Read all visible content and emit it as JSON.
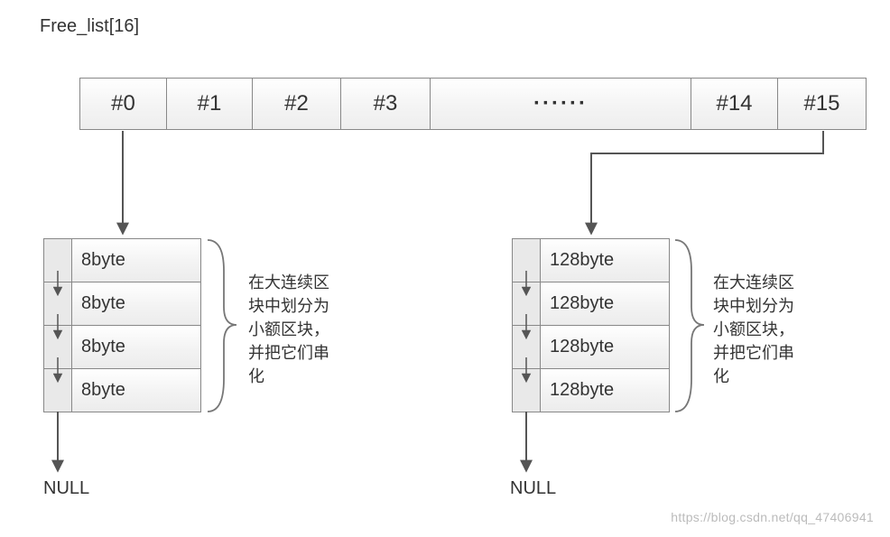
{
  "title": "Free_list[16]",
  "array": {
    "cells": [
      "#0",
      "#1",
      "#2",
      "#3",
      "······",
      "#14",
      "#15"
    ]
  },
  "leftList": {
    "nodeLabel": "8byte",
    "count": 4,
    "null": "NULL"
  },
  "rightList": {
    "nodeLabel": "128byte",
    "count": 4,
    "null": "NULL"
  },
  "annotation": "在大连续区块中划分为小额区块，并把它们串化",
  "watermark": "https://blog.csdn.net/qq_47406941",
  "chart_data": {
    "type": "diagram",
    "structure": "free_list_array_with_linked_lists",
    "array_name": "Free_list",
    "array_size": 16,
    "shown_indices": [
      0,
      1,
      2,
      3,
      14,
      15
    ],
    "lists": [
      {
        "from_index": 0,
        "block_size_bytes": 8,
        "shown_nodes": 4,
        "terminator": "NULL"
      },
      {
        "from_index": 15,
        "block_size_bytes": 128,
        "shown_nodes": 4,
        "terminator": "NULL"
      }
    ],
    "annotation_zh": "在大连续区块中划分为小额区块，并把它们串化",
    "annotation_en_approx": "Split a large contiguous block into small sub-blocks and chain them"
  }
}
